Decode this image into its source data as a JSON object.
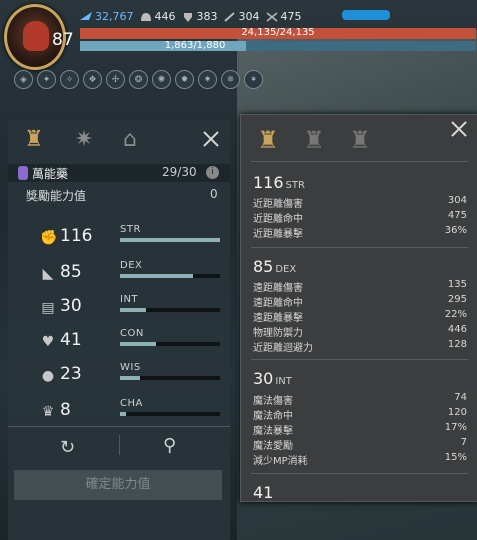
{
  "hud": {
    "level": "87",
    "top_stats": [
      {
        "icon": "wing-icon",
        "value": "32,767",
        "color": "#6ab8ff"
      },
      {
        "icon": "helmet-icon",
        "value": "446"
      },
      {
        "icon": "shield-icon",
        "value": "383"
      },
      {
        "icon": "sword-icon",
        "value": "304"
      },
      {
        "icon": "crossbow-icon",
        "value": "475"
      }
    ],
    "hp_text": "24,135/24,135",
    "mp_text": "1,863/1,880",
    "mp_fraction": 0.99
  },
  "left": {
    "potion_name": "萬能藥",
    "potion_count": "29/30",
    "potion_badge": "i",
    "bonus_label": "獎勵能力值",
    "bonus_value": "0",
    "stats": [
      {
        "value": "116",
        "name": "STR",
        "fill": 1.0,
        "icon": "arm-icon"
      },
      {
        "value": "85",
        "name": "DEX",
        "fill": 0.73,
        "icon": "boot-icon"
      },
      {
        "value": "30",
        "name": "INT",
        "fill": 0.26,
        "icon": "book-icon"
      },
      {
        "value": "41",
        "name": "CON",
        "fill": 0.36,
        "icon": "heart-icon"
      },
      {
        "value": "23",
        "name": "WIS",
        "fill": 0.2,
        "icon": "head-icon"
      },
      {
        "value": "8",
        "name": "CHA",
        "fill": 0.06,
        "icon": "crown-icon"
      }
    ],
    "confirm_label": "確定能力值"
  },
  "right": {
    "sections": [
      {
        "value": "116",
        "name": "STR",
        "rows": [
          {
            "label": "近距離傷害",
            "value": "304"
          },
          {
            "label": "近距離命中",
            "value": "475"
          },
          {
            "label": "近距離暴擊",
            "value": "36%"
          }
        ]
      },
      {
        "value": "85",
        "name": "DEX",
        "rows": [
          {
            "label": "遠距離傷害",
            "value": "135"
          },
          {
            "label": "遠距離命中",
            "value": "295"
          },
          {
            "label": "遠距離暴擊",
            "value": "22%"
          },
          {
            "label": "物理防禦力",
            "value": "446"
          },
          {
            "label": "近距離迴避力",
            "value": "128"
          }
        ]
      },
      {
        "value": "30",
        "name": "INT",
        "rows": [
          {
            "label": "魔法傷害",
            "value": "74"
          },
          {
            "label": "魔法命中",
            "value": "120"
          },
          {
            "label": "魔法暴擊",
            "value": "17%"
          },
          {
            "label": "魔法愛勵",
            "value": "7"
          },
          {
            "label": "減少MP消耗",
            "value": "15%"
          }
        ]
      },
      {
        "value": "41",
        "name": "",
        "rows": []
      }
    ]
  }
}
